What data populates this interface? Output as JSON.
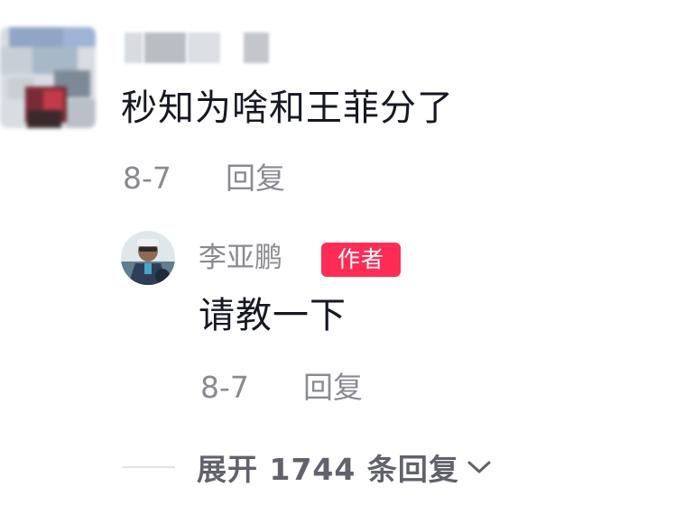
{
  "comment": {
    "text": "秒知为啥和王菲分了",
    "date": "8-7",
    "reply_label": "回复"
  },
  "reply": {
    "username": "李亚鹏",
    "badge": "作者",
    "text": "请教一下",
    "date": "8-7",
    "reply_label": "回复"
  },
  "expand": {
    "label": "展开 1744 条回复"
  },
  "icons": {
    "expand": "chevron-down-icon"
  },
  "colors": {
    "badge": "#fe2c55",
    "text": "#161823",
    "meta": "#8a8b91"
  }
}
